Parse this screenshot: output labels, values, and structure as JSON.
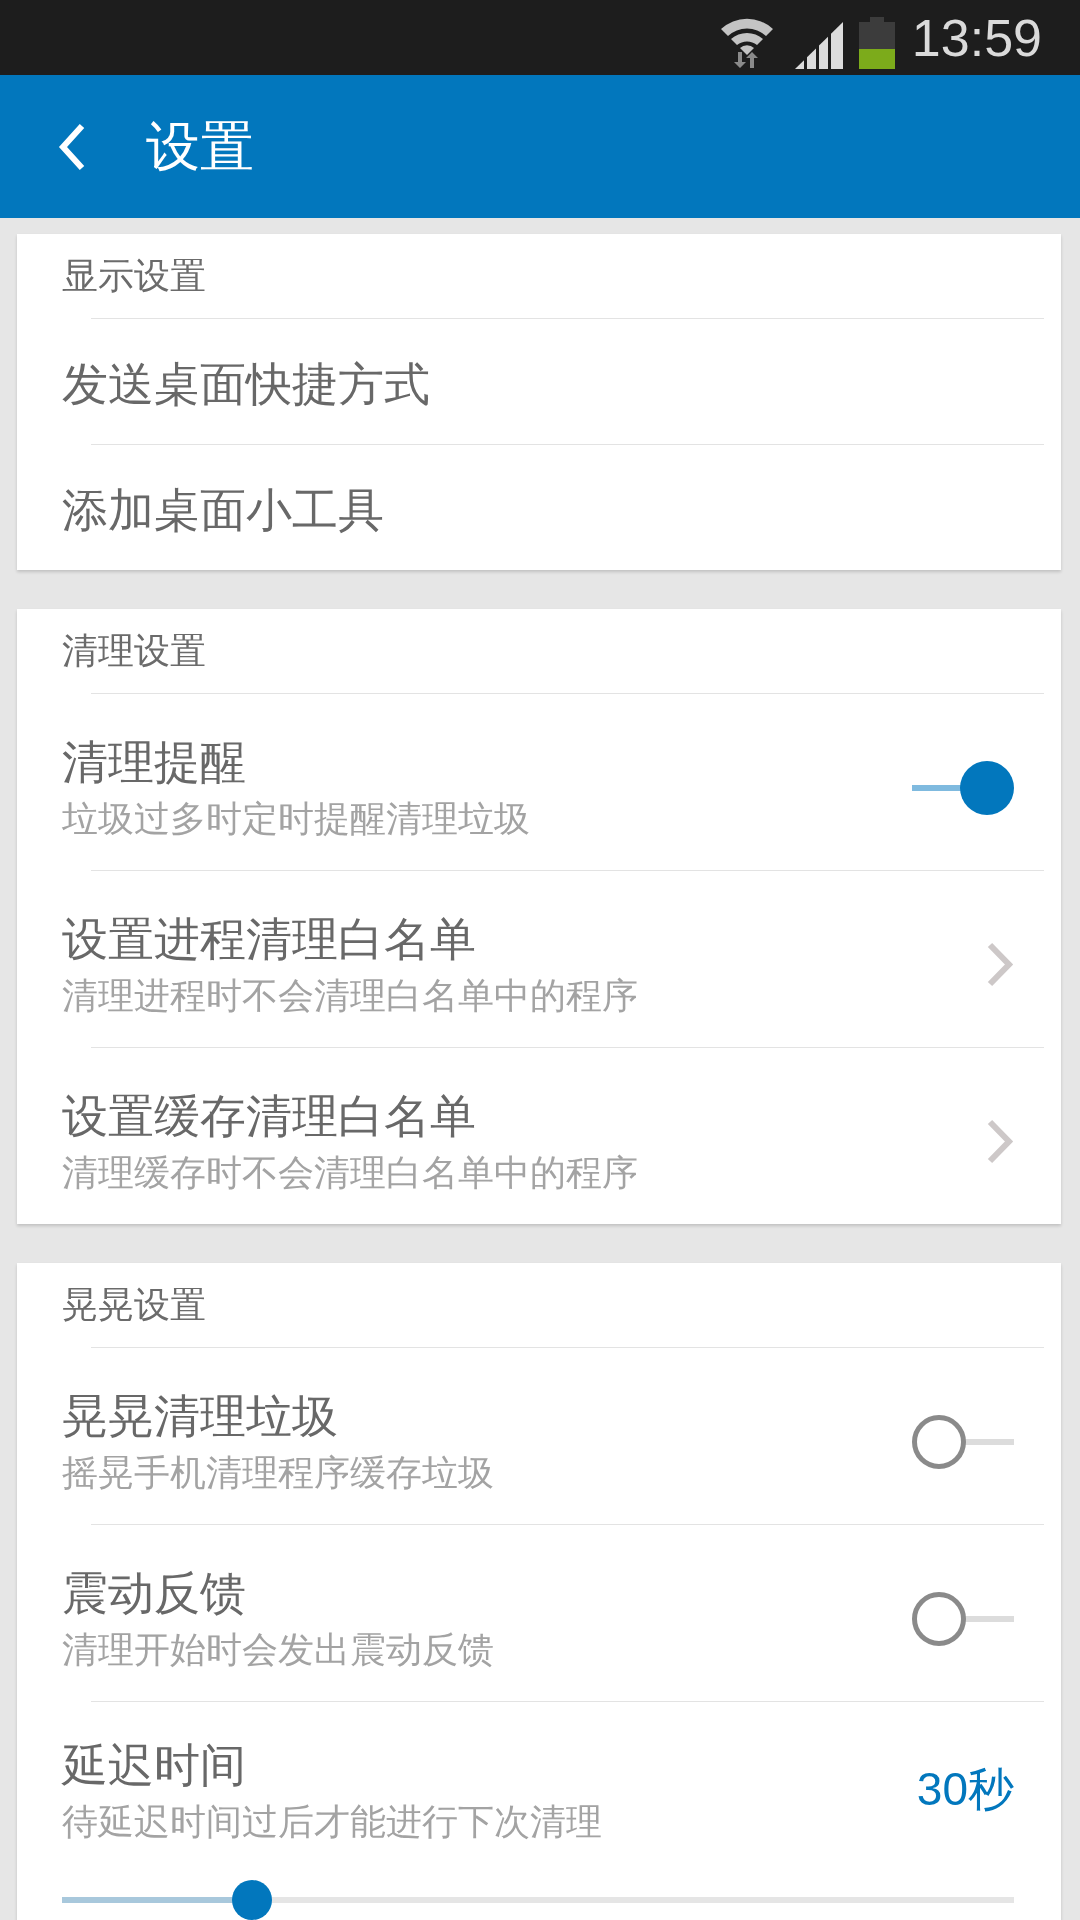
{
  "status_bar": {
    "time": "13:59"
  },
  "app_bar": {
    "title": "设置"
  },
  "sections": [
    {
      "header": "显示设置",
      "items": [
        {
          "kind": "plain",
          "title": "发送桌面快捷方式"
        },
        {
          "kind": "plain",
          "title": "添加桌面小工具"
        }
      ]
    },
    {
      "header": "清理设置",
      "items": [
        {
          "kind": "toggle",
          "title": "清理提醒",
          "subtitle": "垃圾过多时定时提醒清理垃圾",
          "on": true
        },
        {
          "kind": "link",
          "title": "设置进程清理白名单",
          "subtitle": "清理进程时不会清理白名单中的程序"
        },
        {
          "kind": "link",
          "title": "设置缓存清理白名单",
          "subtitle": "清理缓存时不会清理白名单中的程序"
        }
      ]
    },
    {
      "header": "晃晃设置",
      "items": [
        {
          "kind": "toggle",
          "title": "晃晃清理垃圾",
          "subtitle": "摇晃手机清理程序缓存垃圾",
          "on": false
        },
        {
          "kind": "toggle",
          "title": "震动反馈",
          "subtitle": "清理开始时会发出震动反馈",
          "on": false
        },
        {
          "kind": "slider",
          "title": "延迟时间",
          "subtitle": "待延迟时间过后才能进行下次清理",
          "value": "30秒",
          "level": 0.2
        }
      ]
    }
  ]
}
